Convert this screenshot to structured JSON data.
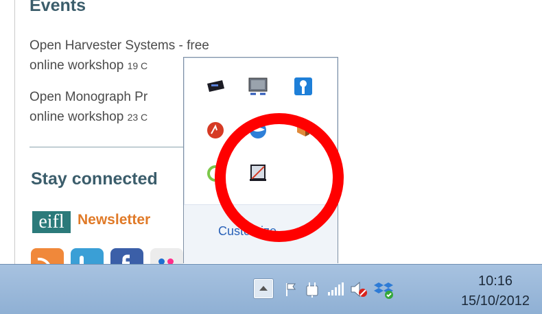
{
  "sidebar": {
    "events_heading": "Events",
    "events": [
      {
        "title": "Open Harvester Systems - free",
        "line2": "online workshop",
        "date": "19 C"
      },
      {
        "title": "Open Monograph Pr",
        "line2": "online workshop",
        "date": "23 C"
      }
    ],
    "stay_heading": "Stay connected",
    "logo_text": "eifl",
    "newsletter": "Newsletter"
  },
  "tray_popup": {
    "customize_label": "Customize..."
  },
  "taskbar": {
    "time": "10:16",
    "date": "15/10/2012",
    "icons": [
      "show-hidden-icons",
      "action-center-flag",
      "power-plug",
      "network-signal",
      "volume-muted",
      "dropbox"
    ]
  },
  "colors": {
    "heading": "#3b5d6b",
    "newsletter": "#e07a28",
    "highlight_ring": "#ff0000",
    "taskbar": "#a7c2e0"
  }
}
